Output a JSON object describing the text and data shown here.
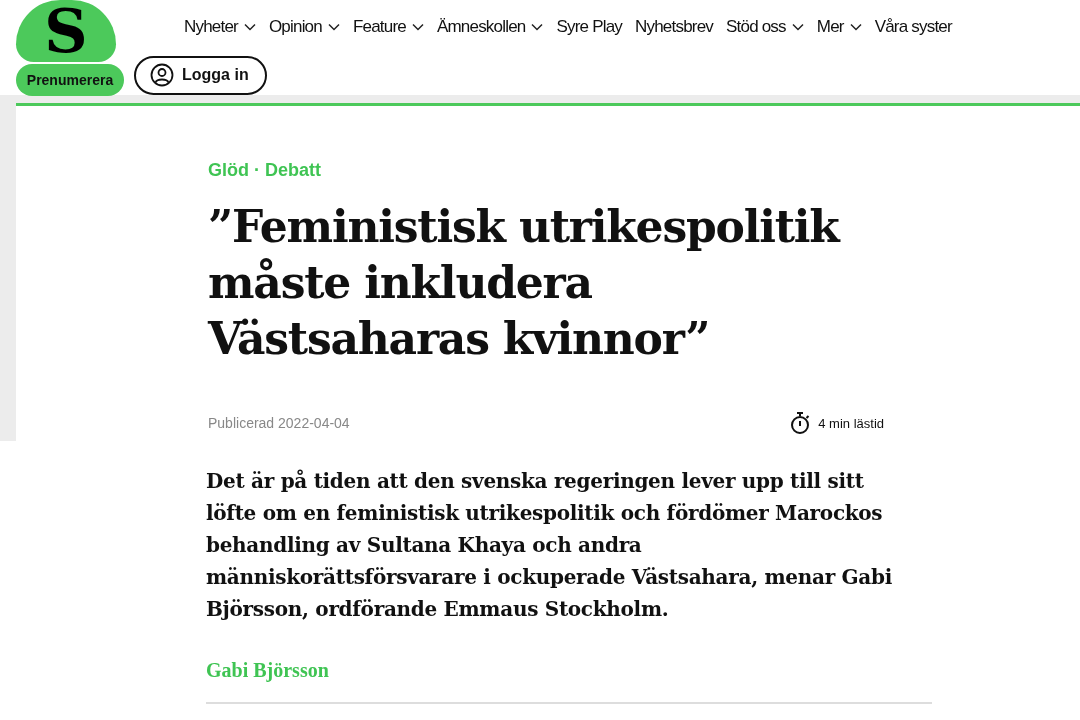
{
  "header": {
    "logo_letter": "S",
    "subscribe_button": "Prenumerera",
    "login_button": "Logga in",
    "nav": [
      {
        "label": "Nyheter",
        "dropdown": true
      },
      {
        "label": "Opinion",
        "dropdown": true
      },
      {
        "label": "Feature",
        "dropdown": true
      },
      {
        "label": "Ämneskollen",
        "dropdown": true
      },
      {
        "label": "Syre Play",
        "dropdown": false
      },
      {
        "label": "Nyhetsbrev",
        "dropdown": false
      },
      {
        "label": "Stöd oss",
        "dropdown": true
      },
      {
        "label": "Mer",
        "dropdown": true
      },
      {
        "label": "Våra syster",
        "dropdown": false
      }
    ]
  },
  "article": {
    "section": "Glöd · Debatt",
    "title": "”Feministisk utrikespolitik måste inkludera Västsaharas kvinnor”",
    "published": "Publicerad 2022-04-04",
    "reading_time": "4 min lästid",
    "lead": "Det är på tiden att den svenska regeringen lever upp till sitt löfte om en feministisk utrikespolitik och fördömer Marockos behandling av Sultana Khaya och andra människorättsförsvarare i ockuperade Västsahara, menar Gabi Björsson, ordförande Emmaus Stockholm.",
    "author": "Gabi Björsson"
  }
}
